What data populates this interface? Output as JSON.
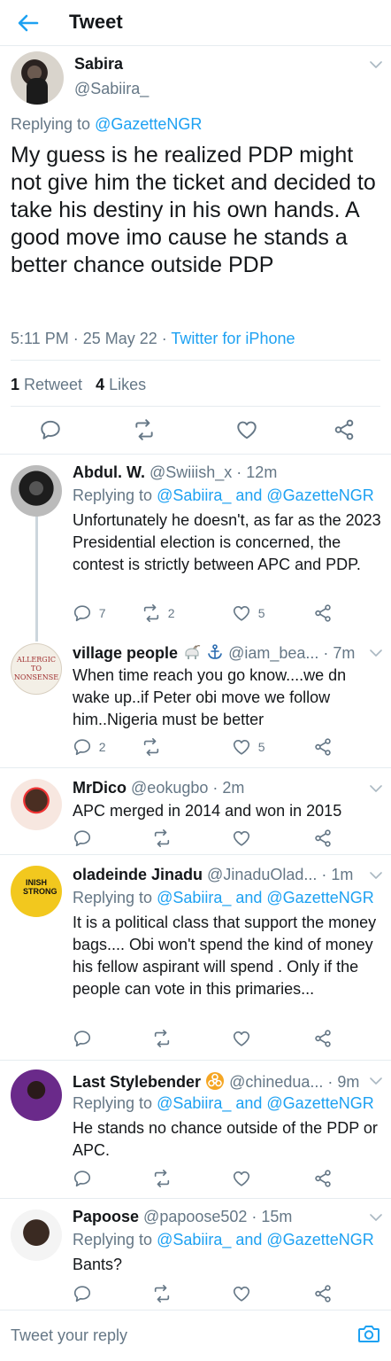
{
  "header": {
    "title": "Tweet"
  },
  "main": {
    "name": "Sabira",
    "handle": "@Sabiira_",
    "replying_prefix": "Replying to ",
    "replying_to": "@GazetteNGR",
    "text": "My guess is he realized PDP might not give him the ticket and decided to take his destiny in his own hands. A good move imo cause he stands a better chance outside PDP",
    "time": "5:11 PM · 25 May 22 · ",
    "source": "Twitter for iPhone",
    "retweets_count": "1",
    "retweets_label": " Retweet",
    "likes_count": "4",
    "likes_label": " Likes"
  },
  "replies": [
    {
      "name": "Abdul. W.",
      "handle": "@Swiiish_x · 12m",
      "replying_prefix": "Replying to ",
      "replying_to": "@Sabiira_ and @GazetteNGR",
      "text": "Unfortunately he doesn't, as far as the 2023 Presidential election is concerned, the contest is strictly between APC and PDP.",
      "comments": "7",
      "retweets": "2",
      "likes": "5"
    },
    {
      "name": "village people",
      "handle": "@iam_bea... · 7m",
      "avatar_text": "ALLERGIC TO NONSENSE",
      "text": "When time reach you go know....we dn wake up..if Peter obi move we follow him..Nigeria must be better",
      "comments": "2",
      "retweets": "",
      "likes": "5"
    },
    {
      "name": "MrDico",
      "handle": "@eokugbo · 2m",
      "text": "APC merged in 2014 and won in 2015",
      "comments": "",
      "retweets": "",
      "likes": ""
    },
    {
      "name": "oladeinde Jinadu",
      "handle": "@JinaduOlad... · 1m",
      "avatar_text": "INISH STRONG",
      "replying_prefix": "Replying to ",
      "replying_to": "@Sabiira_ and @GazetteNGR",
      "text": "It is a political class that support the money bags.... Obi won't spend the kind of money his fellow aspirant will spend . Only if the people can vote in this primaries...",
      "comments": "",
      "retweets": "",
      "likes": ""
    },
    {
      "name": "Last Stylebender",
      "handle": "@chinedua... · 9m",
      "replying_prefix": "Replying to ",
      "replying_to": "@Sabiira_ and @GazetteNGR",
      "text": "He stands no chance outside of the PDP or APC.",
      "comments": "",
      "retweets": "",
      "likes": ""
    },
    {
      "name": "Papoose",
      "handle": "@papoose502 · 15m",
      "replying_prefix": "Replying to ",
      "replying_to": "@Sabiira_ and @GazetteNGR",
      "text": "Bants?",
      "comments": "",
      "retweets": "",
      "likes": ""
    }
  ],
  "compose": {
    "placeholder": "Tweet your reply"
  },
  "colors": {
    "accent": "#1da1f2",
    "secondary_text": "#657786",
    "divider": "#e6ecf0",
    "badge": "#f5a623"
  },
  "icons": [
    "back-arrow-icon",
    "chevron-down-icon",
    "reply-icon",
    "retweet-icon",
    "like-icon",
    "share-icon",
    "goat-emoji-icon",
    "anchor-icon",
    "biohazard-badge-icon",
    "camera-icon"
  ]
}
